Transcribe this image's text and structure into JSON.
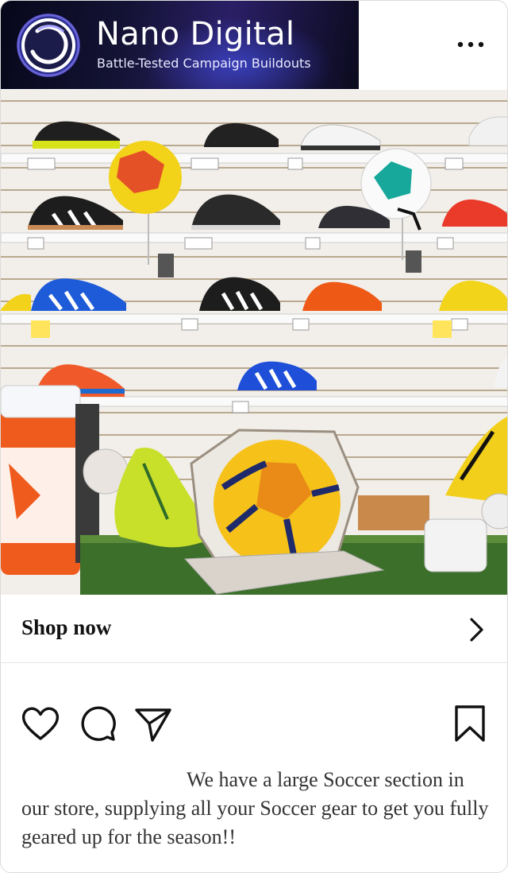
{
  "header": {
    "brand_name": "Nano Digital",
    "tagline": "Battle-Tested Campaign Buildouts",
    "more_icon": "more-horizontal-icon"
  },
  "post": {
    "image_alt": "Soccer section display wall with cleats, balls and gear"
  },
  "cta": {
    "label": "Shop now",
    "icon": "chevron-right-icon"
  },
  "actions": {
    "like_icon": "heart-icon",
    "comment_icon": "comment-icon",
    "share_icon": "send-icon",
    "save_icon": "bookmark-icon"
  },
  "caption": {
    "text": "We have a large Soccer section in our store, supplying all your Soccer gear to get you fully geared up for the season!!"
  },
  "colors": {
    "banner_dark": "#07071a",
    "banner_accent": "#2a1f66",
    "text": "#262626"
  }
}
